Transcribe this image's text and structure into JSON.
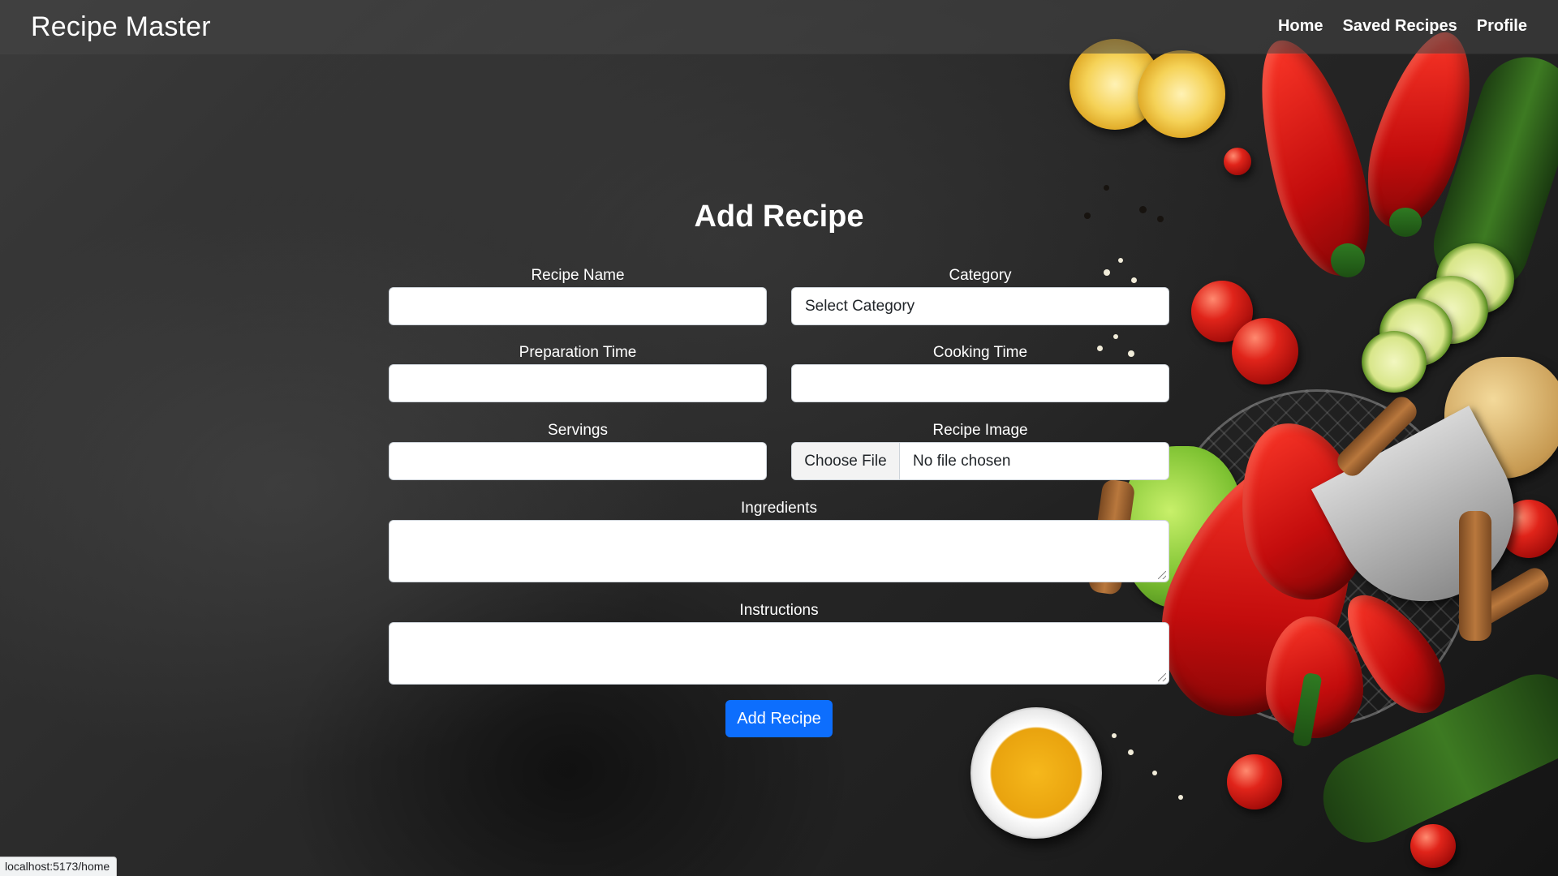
{
  "navbar": {
    "brand": "Recipe Master",
    "links": [
      "Home",
      "Saved Recipes",
      "Profile"
    ]
  },
  "form": {
    "title": "Add Recipe",
    "fields": {
      "recipe_name": {
        "label": "Recipe Name",
        "value": ""
      },
      "category": {
        "label": "Category",
        "selected": "Select Category"
      },
      "preparation_time": {
        "label": "Preparation Time",
        "value": ""
      },
      "cooking_time": {
        "label": "Cooking Time",
        "value": ""
      },
      "servings": {
        "label": "Servings",
        "value": ""
      },
      "recipe_image": {
        "label": "Recipe Image",
        "button": "Choose File",
        "status": "No file chosen"
      },
      "ingredients": {
        "label": "Ingredients",
        "value": ""
      },
      "instructions": {
        "label": "Instructions",
        "value": ""
      }
    },
    "submit_label": "Add Recipe"
  },
  "status_bar": {
    "url": "localhost:5173/home"
  },
  "colors": {
    "primary_button": "#0d6efd",
    "navbar_text": "#ffffff",
    "background": "#2a2a2a"
  }
}
